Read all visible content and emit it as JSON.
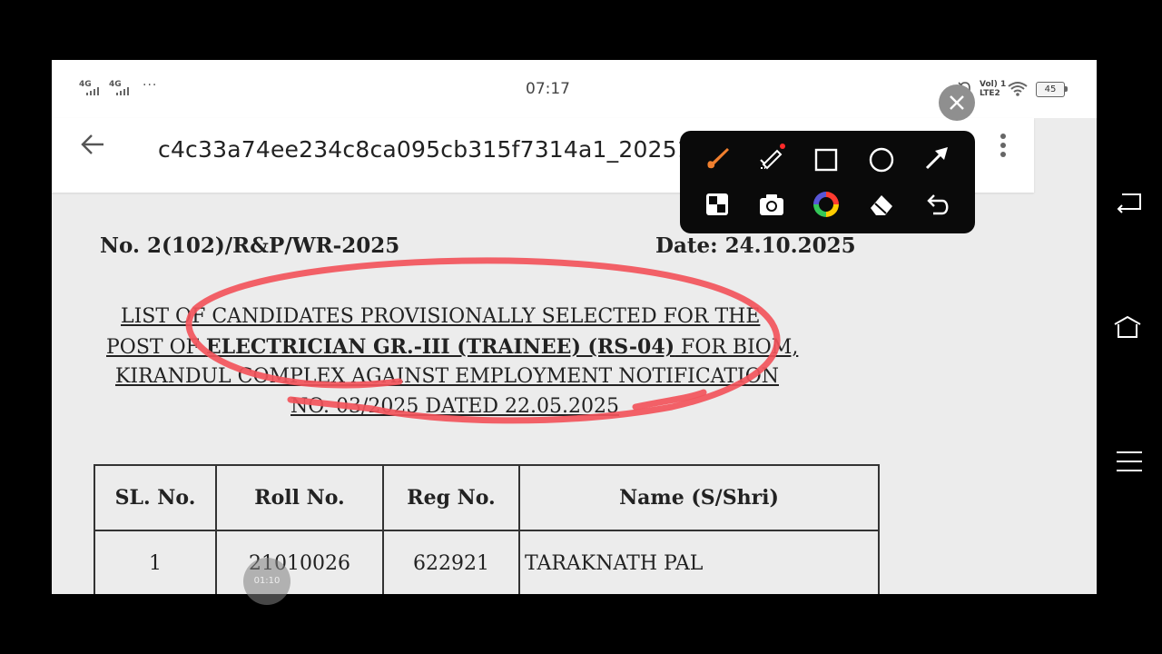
{
  "status_bar": {
    "signal1": "4G",
    "signal2": "4G",
    "more": "···",
    "time": "07:17",
    "lte_line1": "Vol) 1",
    "lte_line2": "LTE2",
    "battery": "45"
  },
  "app_bar": {
    "title": "c4c33a74ee234c8ca095cb315f7314a1_20251024162..."
  },
  "document": {
    "number": "No. 2(102)/R&P/WR-2025",
    "date": "Date: 24.10.2025",
    "heading": {
      "line1": "LIST OF CANDIDATES PROVISIONALLY SELECTED FOR THE",
      "line2_pre": "POST OF ",
      "line2_bold": "ELECTRICIAN GR.-III (TRAINEE) (RS-04)",
      "line2_post": " FOR BIOM,",
      "line3": "KIRANDUL COMPLEX AGAINST EMPLOYMENT NOTIFICATION",
      "line4": "NO. 03/2025 DATED 22.05.2025"
    },
    "table": {
      "headers": [
        "SL. No.",
        "Roll No.",
        "Reg No.",
        "Name (S/Shri)"
      ],
      "rows": [
        [
          "1",
          "21010026",
          "622921",
          "TARAKNATH PAL"
        ]
      ]
    }
  },
  "recorder": {
    "timer": "01:10"
  },
  "colors": {
    "annotation_red": "#f2545b",
    "toolbar_bg": "#0a0a0a",
    "page_bg": "#ececec"
  }
}
